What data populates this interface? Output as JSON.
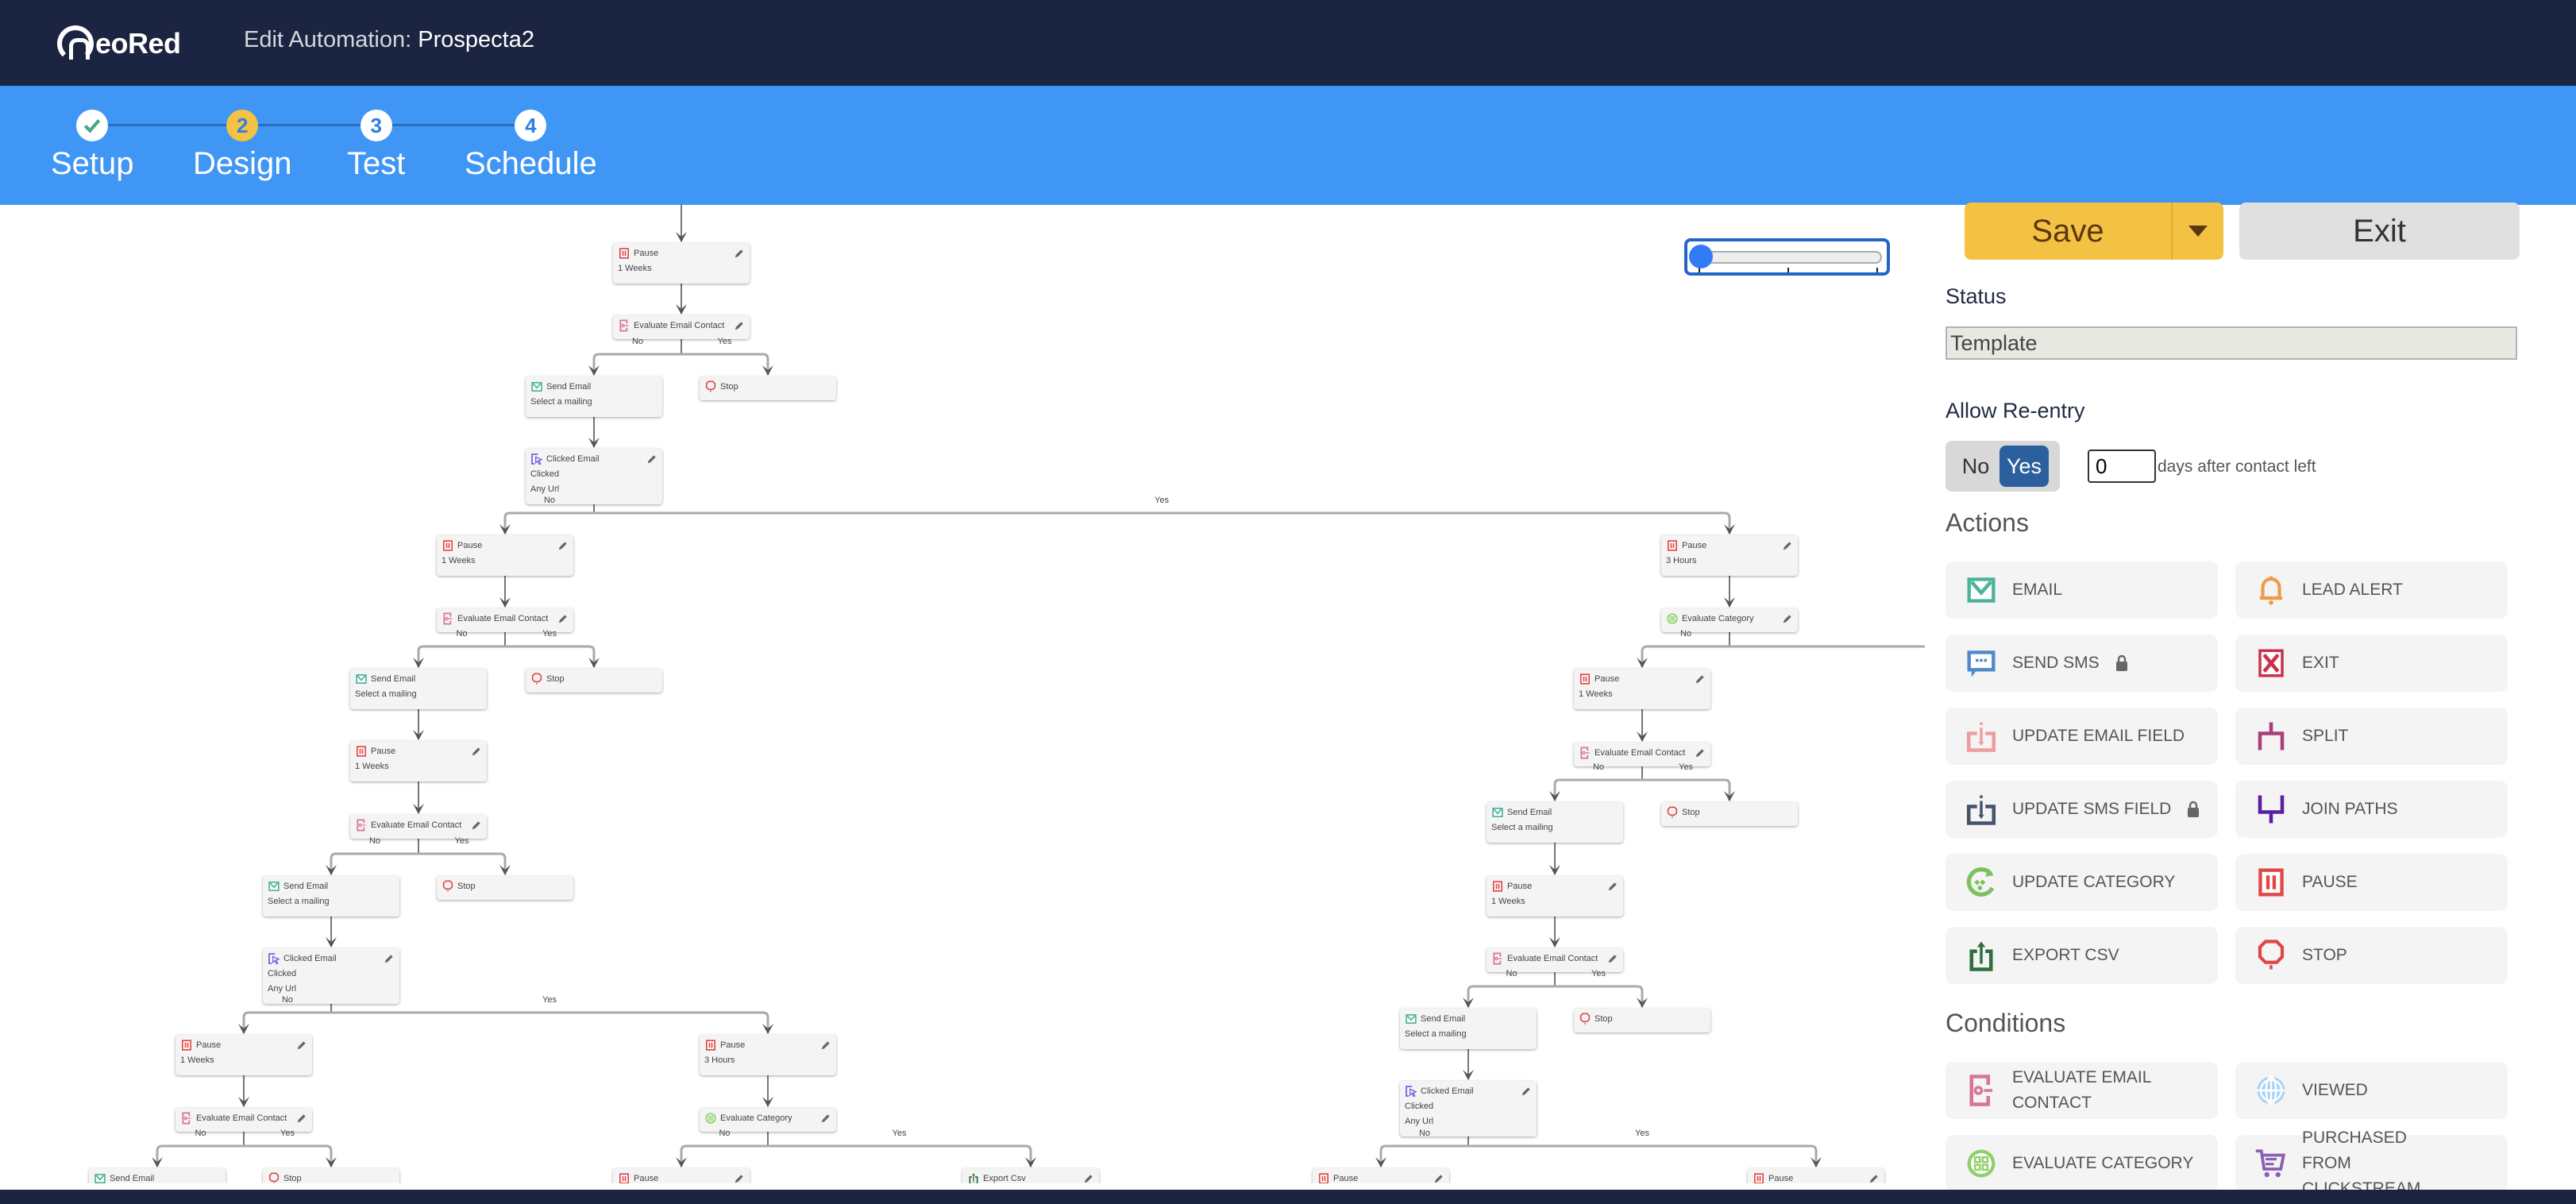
{
  "app": {
    "logo_text": "eoRed",
    "heading_prefix": "Edit Automation: ",
    "automation_name": "Prospecta2"
  },
  "steps": [
    {
      "number": "1",
      "label": "Setup",
      "state": "complete"
    },
    {
      "number": "2",
      "label": "Design",
      "state": "active"
    },
    {
      "number": "3",
      "label": "Test",
      "state": "pending"
    },
    {
      "number": "4",
      "label": "Schedule",
      "state": "pending"
    }
  ],
  "toolbar": {
    "save_label": "Save",
    "exit_label": "Exit"
  },
  "zoom_slider": {
    "value": 0,
    "min": 0,
    "max": 2
  },
  "canvas": {
    "nodes": [
      {
        "id": "n1",
        "type": "pause",
        "title": "Pause",
        "lines": [
          "1 Weeks"
        ],
        "editable": true
      },
      {
        "id": "n2",
        "type": "evaluate-email",
        "title": "Evaluate Email Contact",
        "lines": [],
        "editable": true
      },
      {
        "id": "n3",
        "type": "email",
        "title": "Send Email",
        "lines": [
          "Select a mailing"
        ],
        "editable": false
      },
      {
        "id": "n4",
        "type": "stop",
        "title": "Stop",
        "lines": [],
        "editable": false
      },
      {
        "id": "n5",
        "type": "clicked",
        "title": "Clicked Email",
        "lines": [
          "Clicked",
          "Any Url"
        ],
        "editable": true
      },
      {
        "id": "n6",
        "type": "pause",
        "title": "Pause",
        "lines": [
          "1 Weeks"
        ],
        "editable": true
      },
      {
        "id": "n7",
        "type": "evaluate-email",
        "title": "Evaluate Email Contact",
        "lines": [],
        "editable": true
      },
      {
        "id": "n8",
        "type": "email",
        "title": "Send Email",
        "lines": [
          "Select a mailing"
        ],
        "editable": false
      },
      {
        "id": "n9",
        "type": "stop",
        "title": "Stop",
        "lines": [],
        "editable": false
      },
      {
        "id": "n10",
        "type": "pause",
        "title": "Pause",
        "lines": [
          "1 Weeks"
        ],
        "editable": true
      },
      {
        "id": "n11",
        "type": "evaluate-email",
        "title": "Evaluate Email Contact",
        "lines": [],
        "editable": true
      },
      {
        "id": "n12",
        "type": "email",
        "title": "Send Email",
        "lines": [
          "Select a mailing"
        ],
        "editable": false
      },
      {
        "id": "n13",
        "type": "stop",
        "title": "Stop",
        "lines": [],
        "editable": false
      },
      {
        "id": "n14",
        "type": "clicked",
        "title": "Clicked Email",
        "lines": [
          "Clicked",
          "Any Url"
        ],
        "editable": true
      },
      {
        "id": "n15",
        "type": "pause",
        "title": "Pause",
        "lines": [
          "1 Weeks"
        ],
        "editable": true
      },
      {
        "id": "n16",
        "type": "pause",
        "title": "Pause",
        "lines": [
          "3 Hours"
        ],
        "editable": true
      },
      {
        "id": "n17",
        "type": "evaluate-email",
        "title": "Evaluate Email Contact",
        "lines": [],
        "editable": true
      },
      {
        "id": "n18",
        "type": "evaluate-category",
        "title": "Evaluate Category",
        "lines": [],
        "editable": true
      },
      {
        "id": "n19",
        "type": "email",
        "title": "Send Email",
        "lines": [],
        "editable": false
      },
      {
        "id": "n20",
        "type": "stop",
        "title": "Stop",
        "lines": [],
        "editable": false
      },
      {
        "id": "n21",
        "type": "pause",
        "title": "Pause",
        "lines": [],
        "editable": true
      },
      {
        "id": "n22",
        "type": "export",
        "title": "Export Csv",
        "lines": [],
        "editable": true
      },
      {
        "id": "n23",
        "type": "pause",
        "title": "Pause",
        "lines": [
          "3 Hours"
        ],
        "editable": true
      },
      {
        "id": "n24",
        "type": "evaluate-category",
        "title": "Evaluate Category",
        "lines": [],
        "editable": true
      },
      {
        "id": "n25",
        "type": "pause",
        "title": "Pause",
        "lines": [
          "1 Weeks"
        ],
        "editable": true
      },
      {
        "id": "n26",
        "type": "evaluate-email",
        "title": "Evaluate Email Contact",
        "lines": [],
        "editable": true
      },
      {
        "id": "n27",
        "type": "email",
        "title": "Send Email",
        "lines": [
          "Select a mailing"
        ],
        "editable": false
      },
      {
        "id": "n28",
        "type": "stop",
        "title": "Stop",
        "lines": [],
        "editable": false
      },
      {
        "id": "n29",
        "type": "pause",
        "title": "Pause",
        "lines": [
          "1 Weeks"
        ],
        "editable": true
      },
      {
        "id": "n30",
        "type": "evaluate-email",
        "title": "Evaluate Email Contact",
        "lines": [],
        "editable": true
      },
      {
        "id": "n31",
        "type": "email",
        "title": "Send Email",
        "lines": [
          "Select a mailing"
        ],
        "editable": false
      },
      {
        "id": "n32",
        "type": "stop",
        "title": "Stop",
        "lines": [],
        "editable": false
      },
      {
        "id": "n33",
        "type": "clicked",
        "title": "Clicked Email",
        "lines": [
          "Clicked",
          "Any Url"
        ],
        "editable": true
      },
      {
        "id": "n34",
        "type": "pause",
        "title": "Pause",
        "lines": [],
        "editable": true
      },
      {
        "id": "n35",
        "type": "pause",
        "title": "Pause",
        "lines": [],
        "editable": true
      }
    ],
    "edges": [
      {
        "from": "n1",
        "to": "n2",
        "label": ""
      },
      {
        "from": "n2",
        "to": "n3",
        "label": "No"
      },
      {
        "from": "n2",
        "to": "n4",
        "label": "Yes"
      },
      {
        "from": "n3",
        "to": "n5",
        "label": ""
      },
      {
        "from": "n5",
        "to": "n6",
        "label": "No"
      },
      {
        "from": "n5",
        "to": "n23",
        "label": "Yes"
      },
      {
        "from": "n6",
        "to": "n7",
        "label": ""
      },
      {
        "from": "n7",
        "to": "n8",
        "label": "No"
      },
      {
        "from": "n7",
        "to": "n9",
        "label": "Yes"
      },
      {
        "from": "n8",
        "to": "n10",
        "label": ""
      },
      {
        "from": "n10",
        "to": "n11",
        "label": ""
      },
      {
        "from": "n11",
        "to": "n12",
        "label": "No"
      },
      {
        "from": "n11",
        "to": "n13",
        "label": "Yes"
      },
      {
        "from": "n12",
        "to": "n14",
        "label": ""
      },
      {
        "from": "n14",
        "to": "n15",
        "label": "No"
      },
      {
        "from": "n14",
        "to": "n16",
        "label": "Yes"
      },
      {
        "from": "n15",
        "to": "n17",
        "label": ""
      },
      {
        "from": "n16",
        "to": "n18",
        "label": ""
      },
      {
        "from": "n17",
        "to": "n19",
        "label": "No"
      },
      {
        "from": "n17",
        "to": "n20",
        "label": "Yes"
      },
      {
        "from": "n18",
        "to": "n21",
        "label": "No"
      },
      {
        "from": "n18",
        "to": "n22",
        "label": "Yes"
      },
      {
        "from": "n23",
        "to": "n24",
        "label": ""
      },
      {
        "from": "n24",
        "to": "n25",
        "label": "No"
      },
      {
        "from": "n25",
        "to": "n26",
        "label": ""
      },
      {
        "from": "n26",
        "to": "n27",
        "label": "No"
      },
      {
        "from": "n26",
        "to": "n28",
        "label": "Yes"
      },
      {
        "from": "n27",
        "to": "n29",
        "label": ""
      },
      {
        "from": "n29",
        "to": "n30",
        "label": ""
      },
      {
        "from": "n30",
        "to": "n31",
        "label": "No"
      },
      {
        "from": "n30",
        "to": "n32",
        "label": "Yes"
      },
      {
        "from": "n31",
        "to": "n33",
        "label": ""
      },
      {
        "from": "n33",
        "to": "n34",
        "label": "No"
      },
      {
        "from": "n33",
        "to": "n35",
        "label": "Yes"
      }
    ]
  },
  "panel": {
    "status_label": "Status",
    "status_value": "Template",
    "reentry_label": "Allow Re-entry",
    "reentry_no": "No",
    "reentry_yes": "Yes",
    "reentry_selected": "Yes",
    "reentry_days": "0",
    "reentry_suffix": "days after contact left",
    "actions_title": "Actions",
    "actions": [
      {
        "label": "EMAIL",
        "icon": "email-icon",
        "locked": false
      },
      {
        "label": "LEAD ALERT",
        "icon": "bell-icon",
        "locked": false
      },
      {
        "label": "SEND SMS",
        "icon": "sms-icon",
        "locked": true
      },
      {
        "label": "EXIT",
        "icon": "exit-icon",
        "locked": false
      },
      {
        "label": "UPDATE EMAIL FIELD",
        "icon": "update-email-field-icon",
        "locked": false
      },
      {
        "label": "SPLIT",
        "icon": "split-icon",
        "locked": false
      },
      {
        "label": "UPDATE SMS FIELD",
        "icon": "update-sms-field-icon",
        "locked": true
      },
      {
        "label": "JOIN PATHS",
        "icon": "join-paths-icon",
        "locked": false
      },
      {
        "label": "UPDATE CATEGORY",
        "icon": "update-category-icon",
        "locked": false
      },
      {
        "label": "PAUSE",
        "icon": "pause-icon",
        "locked": false
      },
      {
        "label": "EXPORT CSV",
        "icon": "export-csv-icon",
        "locked": false
      },
      {
        "label": "STOP",
        "icon": "stop-icon",
        "locked": false
      }
    ],
    "conditions_title": "Conditions",
    "conditions": [
      {
        "label": "EVALUATE EMAIL CONTACT",
        "icon": "evaluate-email-icon"
      },
      {
        "label": "VIEWED",
        "icon": "globe-icon"
      },
      {
        "label": "EVALUATE CATEGORY",
        "icon": "evaluate-category-icon"
      },
      {
        "label": "PURCHASED FROM CLICKSTREAM",
        "icon": "cart-icon"
      }
    ]
  },
  "colors": {
    "topbar": "#1b2440",
    "stepbar": "#4096f5",
    "accent_yellow": "#f4c242",
    "toggle_active": "#2b5f9e"
  }
}
